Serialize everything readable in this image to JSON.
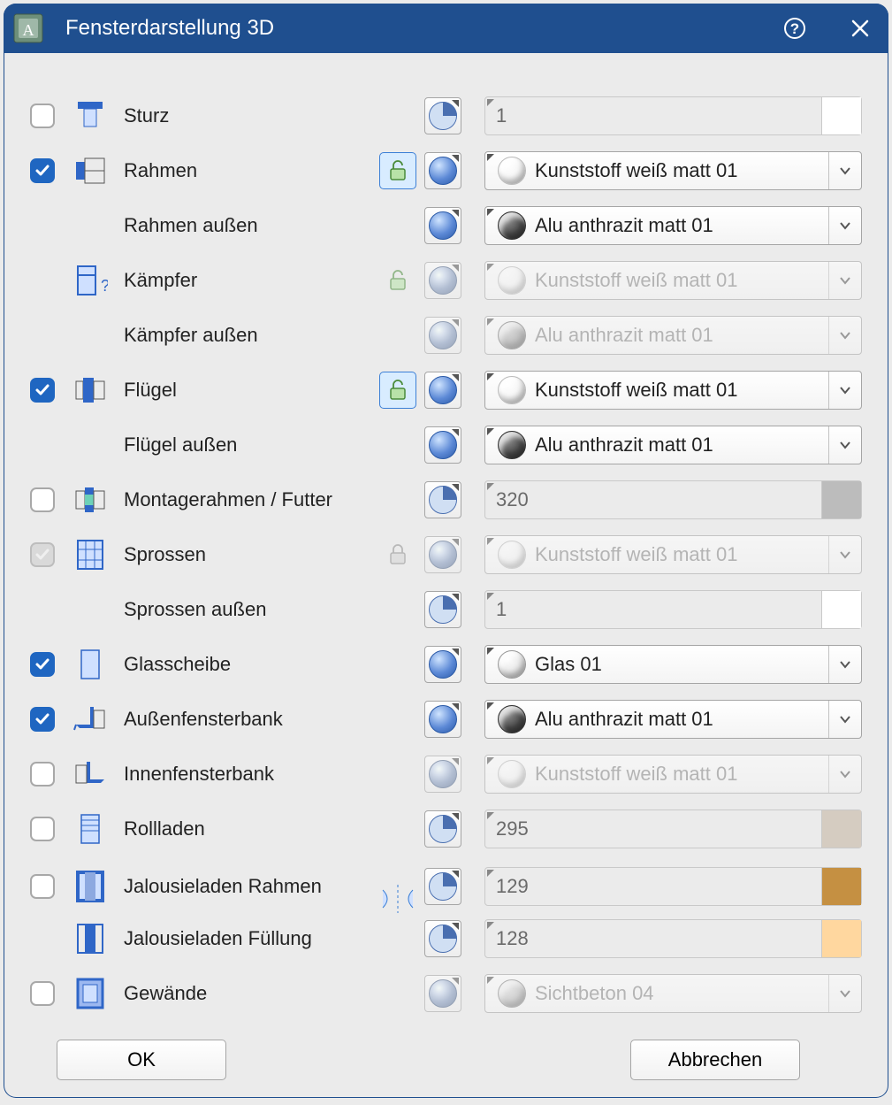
{
  "title": "Fensterdarstellung 3D",
  "buttons": {
    "ok": "OK",
    "cancel": "Abbrechen"
  },
  "rows": {
    "sturz": {
      "label": "Sturz",
      "value": "1",
      "swatch": "#ffffff"
    },
    "rahmen": {
      "label": "Rahmen",
      "material": "Kunststoff weiß matt 01"
    },
    "rahmen_aussen": {
      "label": "Rahmen außen",
      "material": "Alu anthrazit matt 01"
    },
    "kaempfer": {
      "label": "Kämpfer",
      "material": "Kunststoff weiß matt 01"
    },
    "kaempfer_aussen": {
      "label": "Kämpfer außen",
      "material": "Alu anthrazit matt 01"
    },
    "fluegel": {
      "label": "Flügel",
      "material": "Kunststoff weiß matt 01"
    },
    "fluegel_aussen": {
      "label": "Flügel außen",
      "material": "Alu anthrazit matt 01"
    },
    "montagerahmen": {
      "label": "Montagerahmen / Futter",
      "value": "320",
      "swatch": "#bcbcbc"
    },
    "sprossen": {
      "label": "Sprossen",
      "material": "Kunststoff weiß matt 01"
    },
    "sprossen_aussen": {
      "label": "Sprossen außen",
      "value": "1",
      "swatch": "#ffffff"
    },
    "glasscheibe": {
      "label": "Glasscheibe",
      "material": "Glas 01"
    },
    "aussenfensterbank": {
      "label": "Außenfensterbank",
      "material": "Alu anthrazit matt 01"
    },
    "innenfensterbank": {
      "label": "Innenfensterbank",
      "material": "Kunststoff weiß matt 01"
    },
    "rollladen": {
      "label": "Rollladen",
      "value": "295",
      "swatch": "#d5ccc1"
    },
    "jalousie_rahmen": {
      "label": "Jalousieladen Rahmen",
      "value": "129",
      "swatch": "#c59042"
    },
    "jalousie_fuellung": {
      "label": "Jalousieladen Füllung",
      "value": "128",
      "swatch": "#ffd79f"
    },
    "gewaende": {
      "label": "Gewände",
      "material": "Sichtbeton 04"
    }
  }
}
